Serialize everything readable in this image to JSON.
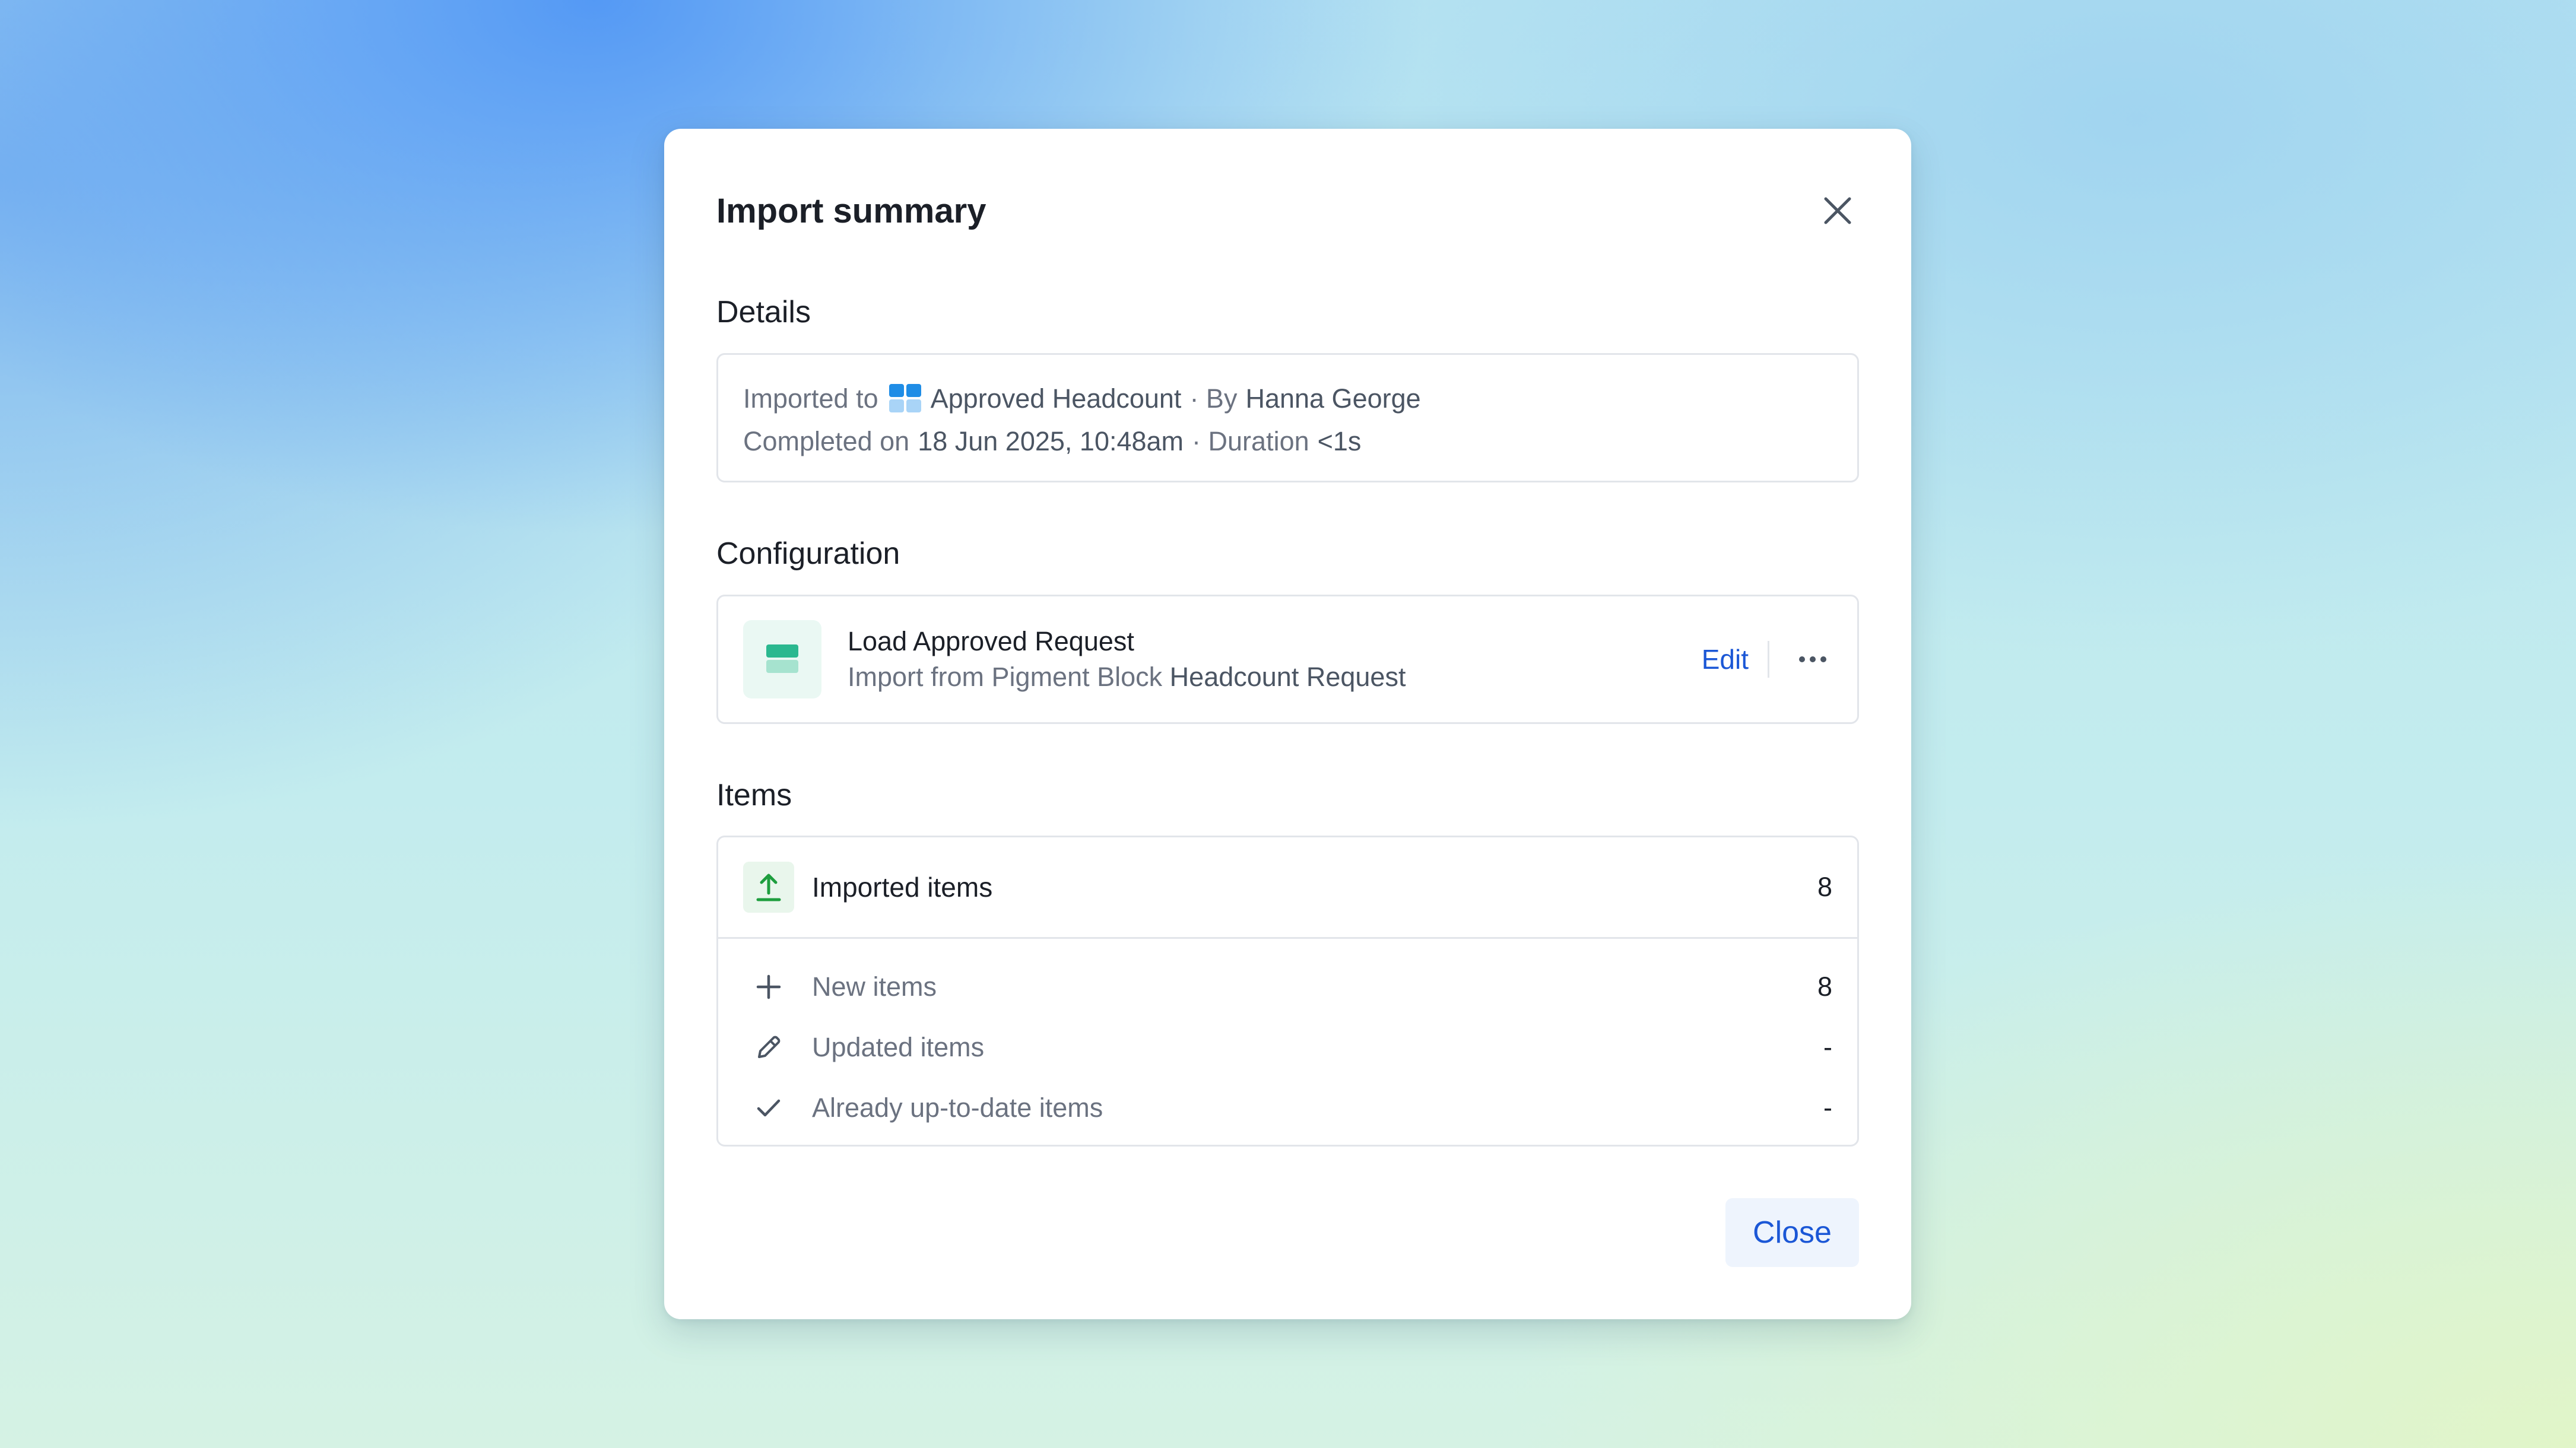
{
  "modal": {
    "title": "Import summary",
    "close_label": "Close"
  },
  "details": {
    "section_title": "Details",
    "imported_to_prefix": "Imported to",
    "imported_to_target": "Approved Headcount",
    "by_prefix": "· By",
    "by_user": "Hanna George",
    "completed_prefix": "Completed on",
    "completed_value": "18 Jun 2025, 10:48am",
    "duration_prefix": "· Duration",
    "duration_value": "<1s"
  },
  "configuration": {
    "section_title": "Configuration",
    "name": "Load Approved Request",
    "source_prefix": "Import from Pigment Block",
    "source_block": "Headcount Request",
    "edit_label": "Edit"
  },
  "items": {
    "section_title": "Items",
    "imported": {
      "label": "Imported items",
      "count": "8"
    },
    "rows": [
      {
        "label": "New items",
        "count": "8",
        "icon": "plus-icon"
      },
      {
        "label": "Updated items",
        "count": "-",
        "icon": "pencil-icon"
      },
      {
        "label": "Already up-to-date items",
        "count": "-",
        "icon": "check-icon"
      }
    ]
  },
  "colors": {
    "accent_blue": "#1b57d6",
    "upload_green": "#1e9e3e",
    "config_teal": "#2bb88f",
    "grid_blue": "#1f8de6"
  }
}
